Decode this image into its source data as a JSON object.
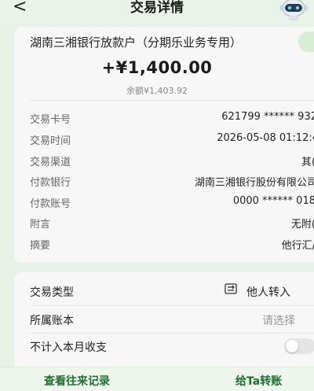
{
  "header": {
    "back_glyph": "<",
    "title": "交易详情"
  },
  "transaction": {
    "title": "湖南三湘银行放款户（分期乐业务专用）",
    "amount": "+¥1,400.00",
    "balance": "余额¥1,403.92"
  },
  "details": [
    {
      "label": "交易卡号",
      "value": "621799 ****** 932"
    },
    {
      "label": "交易时间",
      "value": "2026-05-08 01:12:4"
    },
    {
      "label": "交易渠道",
      "value": "其("
    },
    {
      "label": "付款银行",
      "value": "湖南三湘银行股份有限公司"
    },
    {
      "label": "付款账号",
      "value": "0000 ****** 018"
    },
    {
      "label": "附言",
      "value": "无附("
    },
    {
      "label": "摘要",
      "value": "他行汇/"
    }
  ],
  "classification": {
    "type_label": "交易类型",
    "type_value": "他人转入",
    "account_label": "所属账本",
    "account_value": "请选择",
    "exclude_label": "不计入本月收支",
    "exclude_on": false
  },
  "bottom_bar": {
    "history_label": "查看往来记录",
    "transfer_label": "给Ta转账"
  },
  "colors": {
    "accent_green": "#1f6e2f",
    "background": "#e9f2e8",
    "card": "#f7f7f7"
  },
  "icons": [
    "back-icon",
    "robot-assistant-icon",
    "transfer-in-icon",
    "toggle-switch"
  ]
}
